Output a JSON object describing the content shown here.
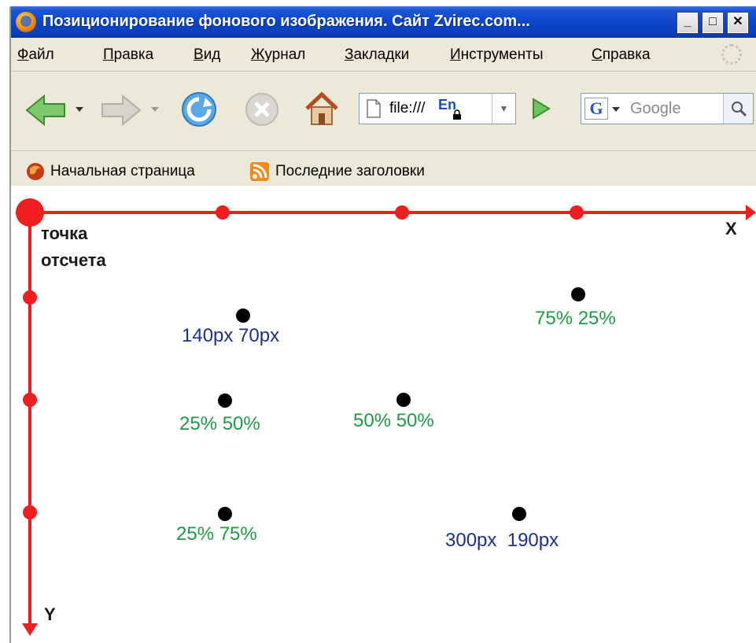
{
  "window": {
    "title": "Позиционирование фонового изображения. Сайт Zvirec.com...",
    "controls": {
      "minimize": "_",
      "maximize": "□",
      "close": "✕"
    }
  },
  "menu": {
    "items": [
      {
        "underlined": "Ф",
        "rest": "айл"
      },
      {
        "underlined": "П",
        "rest": "равка"
      },
      {
        "underlined": "В",
        "rest": "ид"
      },
      {
        "underlined": "Ж",
        "rest": "урнал"
      },
      {
        "underlined": "З",
        "rest": "акладки"
      },
      {
        "underlined": "И",
        "rest": "нструменты"
      },
      {
        "underlined": "С",
        "rest": "правка"
      }
    ]
  },
  "toolbar": {
    "address": "file:///",
    "lang_badge": "En",
    "search_engine_letter": "G",
    "search_placeholder": "Google",
    "icons": [
      "back-arrow-icon",
      "forward-arrow-icon",
      "reload-icon",
      "stop-icon",
      "home-icon",
      "page-icon",
      "go-icon",
      "magnifier-icon"
    ]
  },
  "bookmarks": {
    "items": [
      {
        "label": "Начальная страница",
        "icon": "firefox-bookmark-icon"
      },
      {
        "label": "Последние заголовки",
        "icon": "rss-feed-icon"
      }
    ]
  },
  "diagram": {
    "origin_label_line1": "точка",
    "origin_label_line2": "отсчета",
    "x_axis_label": "X",
    "y_axis_label": "Y",
    "axis_color": "#f01e1e",
    "points": [
      {
        "label": "140px 70px",
        "color": "#1e2f8c"
      },
      {
        "label": "75% 25%",
        "color": "#1f9a47"
      },
      {
        "label": "25% 50%",
        "color": "#1f9a47"
      },
      {
        "label": "50% 50%",
        "color": "#1f9a47"
      },
      {
        "label": "25% 75%",
        "color": "#1f9a47"
      },
      {
        "label": "300px  190px",
        "color": "#1e2f8c"
      }
    ]
  }
}
